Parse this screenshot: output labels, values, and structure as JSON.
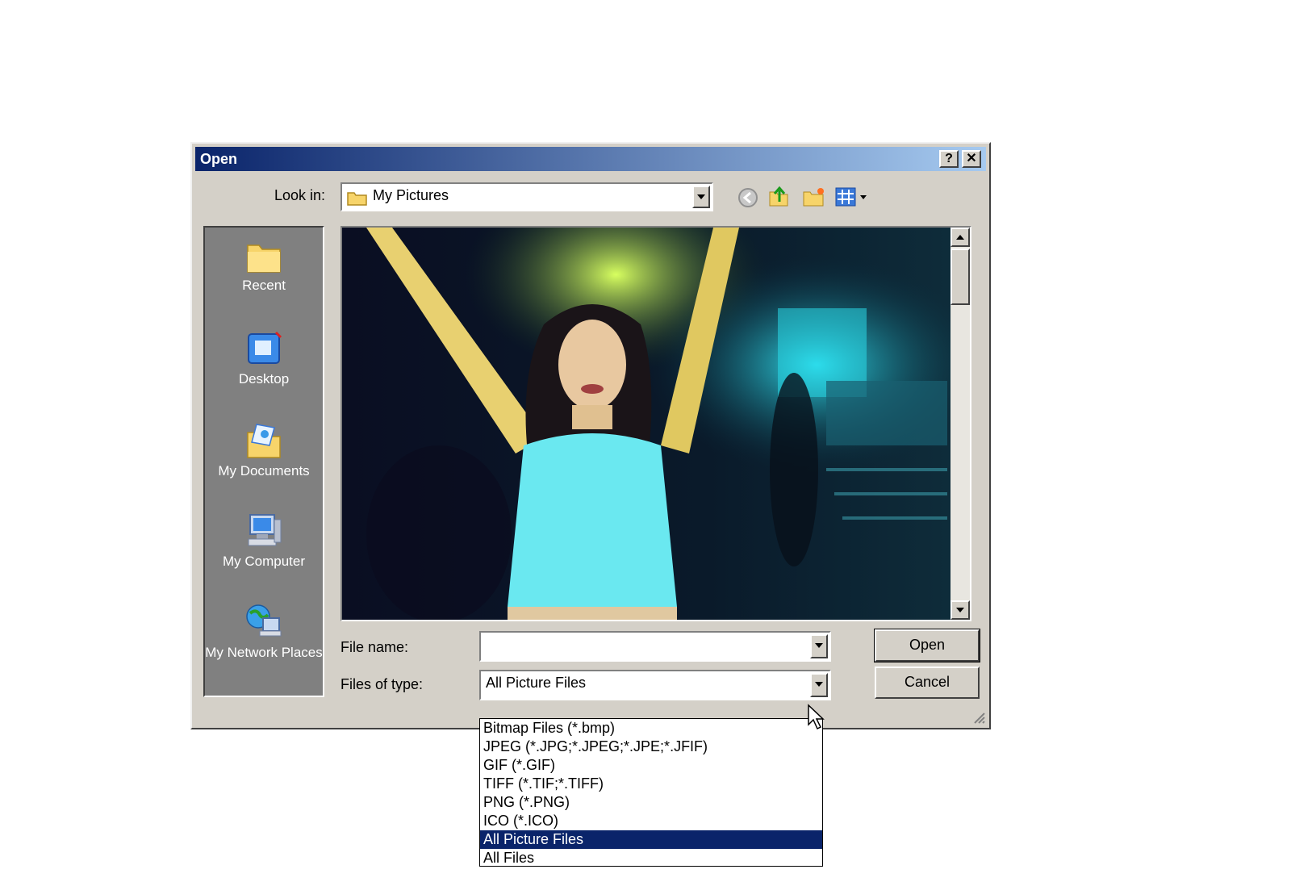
{
  "dialog": {
    "title": "Open",
    "help_label": "?",
    "close_label": "✕"
  },
  "look_in": {
    "label": "Look in:",
    "value": "My Pictures"
  },
  "places": [
    {
      "label": "Recent",
      "icon": "folder-icon"
    },
    {
      "label": "Desktop",
      "icon": "desktop-icon"
    },
    {
      "label": "My Documents",
      "icon": "my-documents-icon"
    },
    {
      "label": "My Computer",
      "icon": "my-computer-icon"
    },
    {
      "label": "My Network Places",
      "icon": "network-places-icon"
    }
  ],
  "file_name": {
    "label": "File name:",
    "value": ""
  },
  "files_of_type": {
    "label": "Files of type:",
    "value": "All Picture Files",
    "options": [
      "Bitmap Files (*.bmp)",
      "JPEG (*.JPG;*.JPEG;*.JPE;*.JFIF)",
      "GIF (*.GIF)",
      "TIFF (*.TIF;*.TIFF)",
      "PNG (*.PNG)",
      "ICO (*.ICO)",
      "All Picture Files",
      "All Files"
    ],
    "selected_index": 6
  },
  "buttons": {
    "open": "Open",
    "cancel": "Cancel"
  }
}
